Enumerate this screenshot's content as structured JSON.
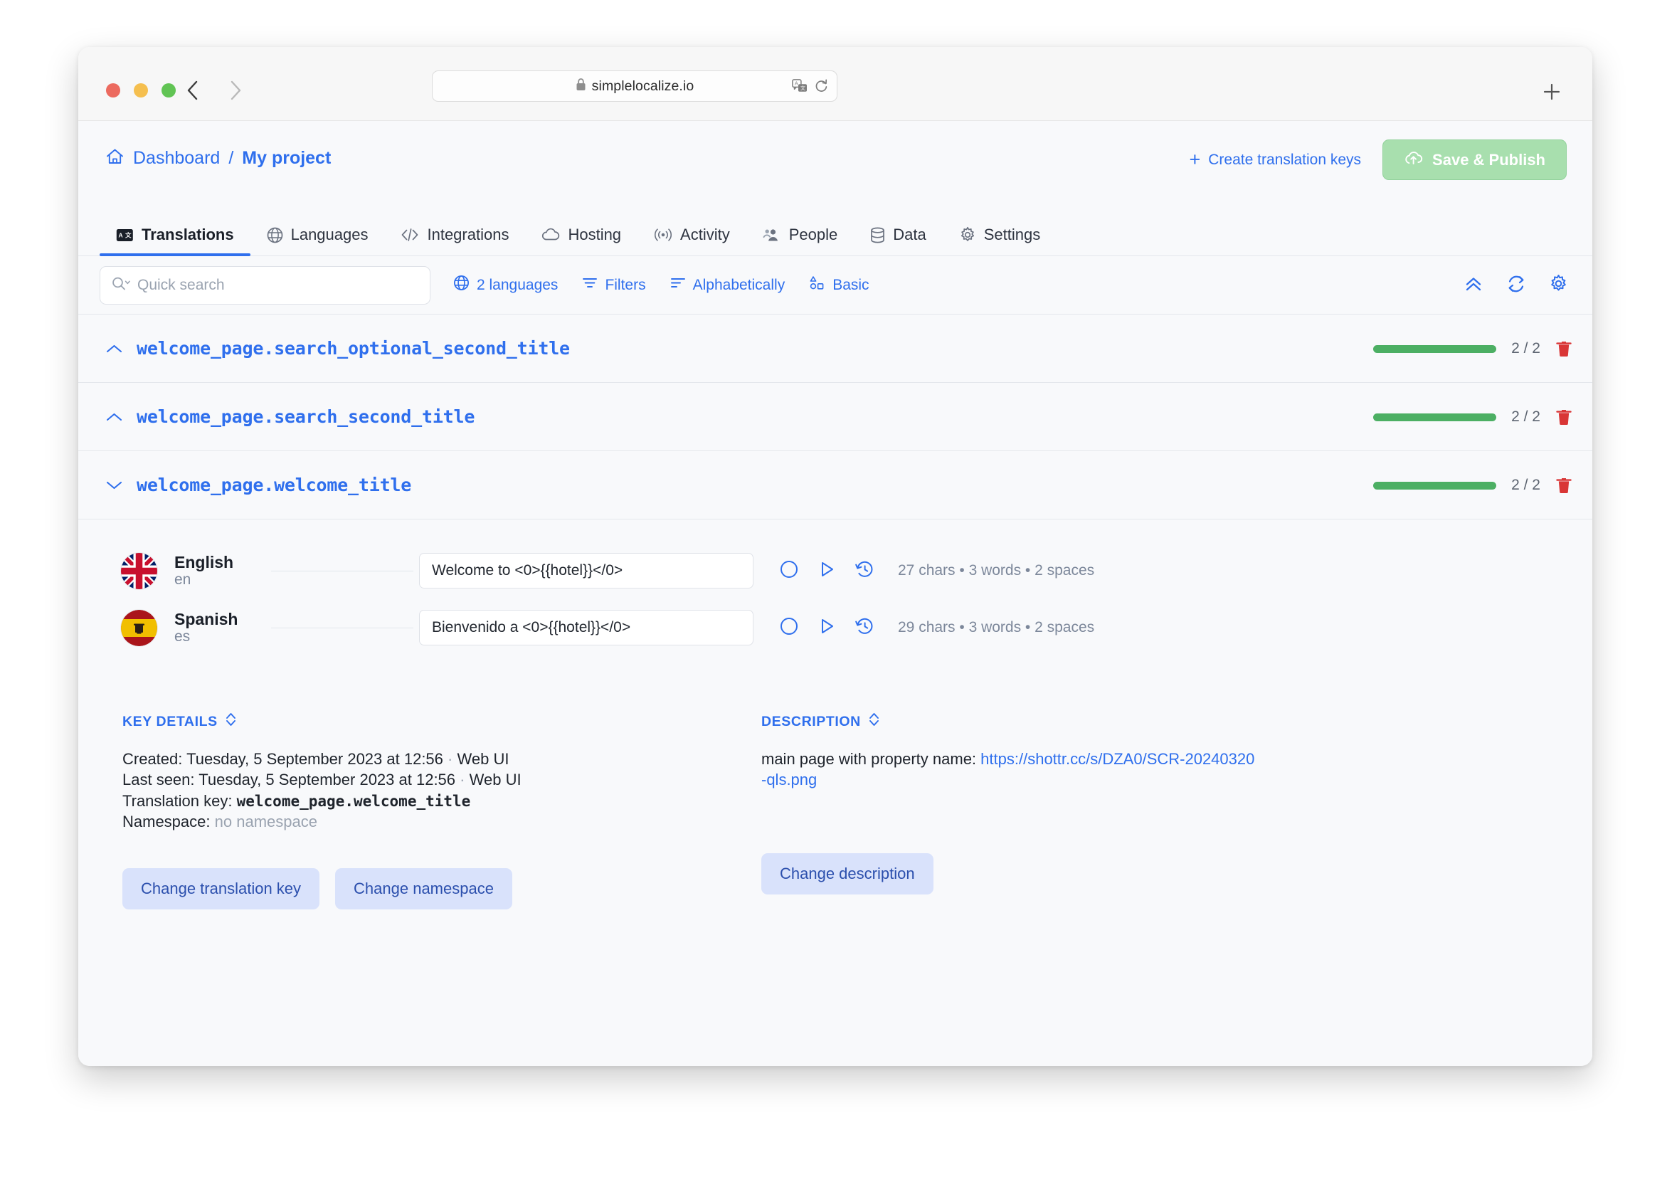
{
  "browser": {
    "url": "simplelocalize.io",
    "lock_icon": "lock-icon",
    "translate_icon": "translate-page-icon",
    "reload_icon": "reload-icon",
    "back_icon": "back-arrow-icon",
    "forward_icon": "forward-arrow-icon",
    "new_tab_icon": "plus-icon"
  },
  "header": {
    "home_icon": "home-icon",
    "breadcrumb_root": "Dashboard",
    "breadcrumb_sep": "/",
    "breadcrumb_current": "My project",
    "create_keys_label": "Create translation keys",
    "create_keys_plus": "+",
    "save_publish_label": "Save & Publish",
    "save_publish_icon": "cloud-upload-icon",
    "save_publish_color": "#a8dfae",
    "accent_color": "#2f6fed"
  },
  "tabs": [
    {
      "label": "Translations",
      "icon": "translate-badge-icon",
      "active": true
    },
    {
      "label": "Languages",
      "icon": "globe-icon",
      "active": false
    },
    {
      "label": "Integrations",
      "icon": "code-brackets-icon",
      "active": false
    },
    {
      "label": "Hosting",
      "icon": "cloud-icon",
      "active": false
    },
    {
      "label": "Activity",
      "icon": "broadcast-icon",
      "active": false
    },
    {
      "label": "People",
      "icon": "people-icon",
      "active": false
    },
    {
      "label": "Data",
      "icon": "database-icon",
      "active": false
    },
    {
      "label": "Settings",
      "icon": "gear-icon",
      "active": false
    }
  ],
  "toolbar": {
    "search_placeholder": "Quick search",
    "search_value": "",
    "search_icon": "search-chevron-icon",
    "links": [
      {
        "label": "2 languages",
        "icon": "globe-icon"
      },
      {
        "label": "Filters",
        "icon": "filter-icon"
      },
      {
        "label": "Alphabetically",
        "icon": "sort-icon"
      },
      {
        "label": "Basic",
        "icon": "layout-basic-icon"
      }
    ],
    "right_icons": [
      {
        "name": "collapse-all-icon"
      },
      {
        "name": "refresh-icon"
      },
      {
        "name": "settings-gear-icon"
      }
    ]
  },
  "keys": [
    {
      "name": "welcome_page.search_optional_second_title",
      "expanded": false,
      "chevron": "chevron-up-icon",
      "progress_pct": 100,
      "count": "2 / 2"
    },
    {
      "name": "welcome_page.search_second_title",
      "expanded": false,
      "chevron": "chevron-up-icon",
      "progress_pct": 100,
      "count": "2 / 2"
    },
    {
      "name": "welcome_page.welcome_title",
      "expanded": true,
      "chevron": "chevron-down-icon",
      "progress_pct": 100,
      "count": "2 / 2"
    }
  ],
  "translations": [
    {
      "language": "English",
      "code": "en",
      "flag": "uk-flag",
      "value": "Welcome to <0>{{hotel}}</0>",
      "stats": "27 chars • 3 words • 2 spaces",
      "icons": [
        "circle-icon",
        "play-icon",
        "history-icon"
      ]
    },
    {
      "language": "Spanish",
      "code": "es",
      "flag": "spain-flag",
      "value": "Bienvenido a <0>{{hotel}}</0>",
      "stats": "29 chars • 3 words • 2 spaces",
      "icons": [
        "circle-icon",
        "play-icon",
        "history-icon"
      ]
    }
  ],
  "key_details": {
    "section_title": "KEY DETAILS",
    "toggle_icon": "sort-toggle-icon",
    "created_label": "Created:",
    "created_value": "Tuesday, 5 September 2023 at 12:56",
    "created_source": "Web UI",
    "last_seen_label": "Last seen:",
    "last_seen_value": "Tuesday, 5 September 2023 at 12:56",
    "last_seen_source": "Web UI",
    "translation_key_label": "Translation key:",
    "translation_key_value": "welcome_page.welcome_title",
    "namespace_label": "Namespace:",
    "namespace_value": "no namespace",
    "buttons": [
      {
        "label": "Change translation key"
      },
      {
        "label": "Change namespace"
      }
    ]
  },
  "description": {
    "section_title": "DESCRIPTION",
    "toggle_icon": "sort-toggle-icon",
    "text_prefix": "main page with property name: ",
    "link": "https://shottr.cc/s/DZA0/SCR-20240320-qls.png",
    "buttons": [
      {
        "label": "Change description"
      }
    ]
  }
}
